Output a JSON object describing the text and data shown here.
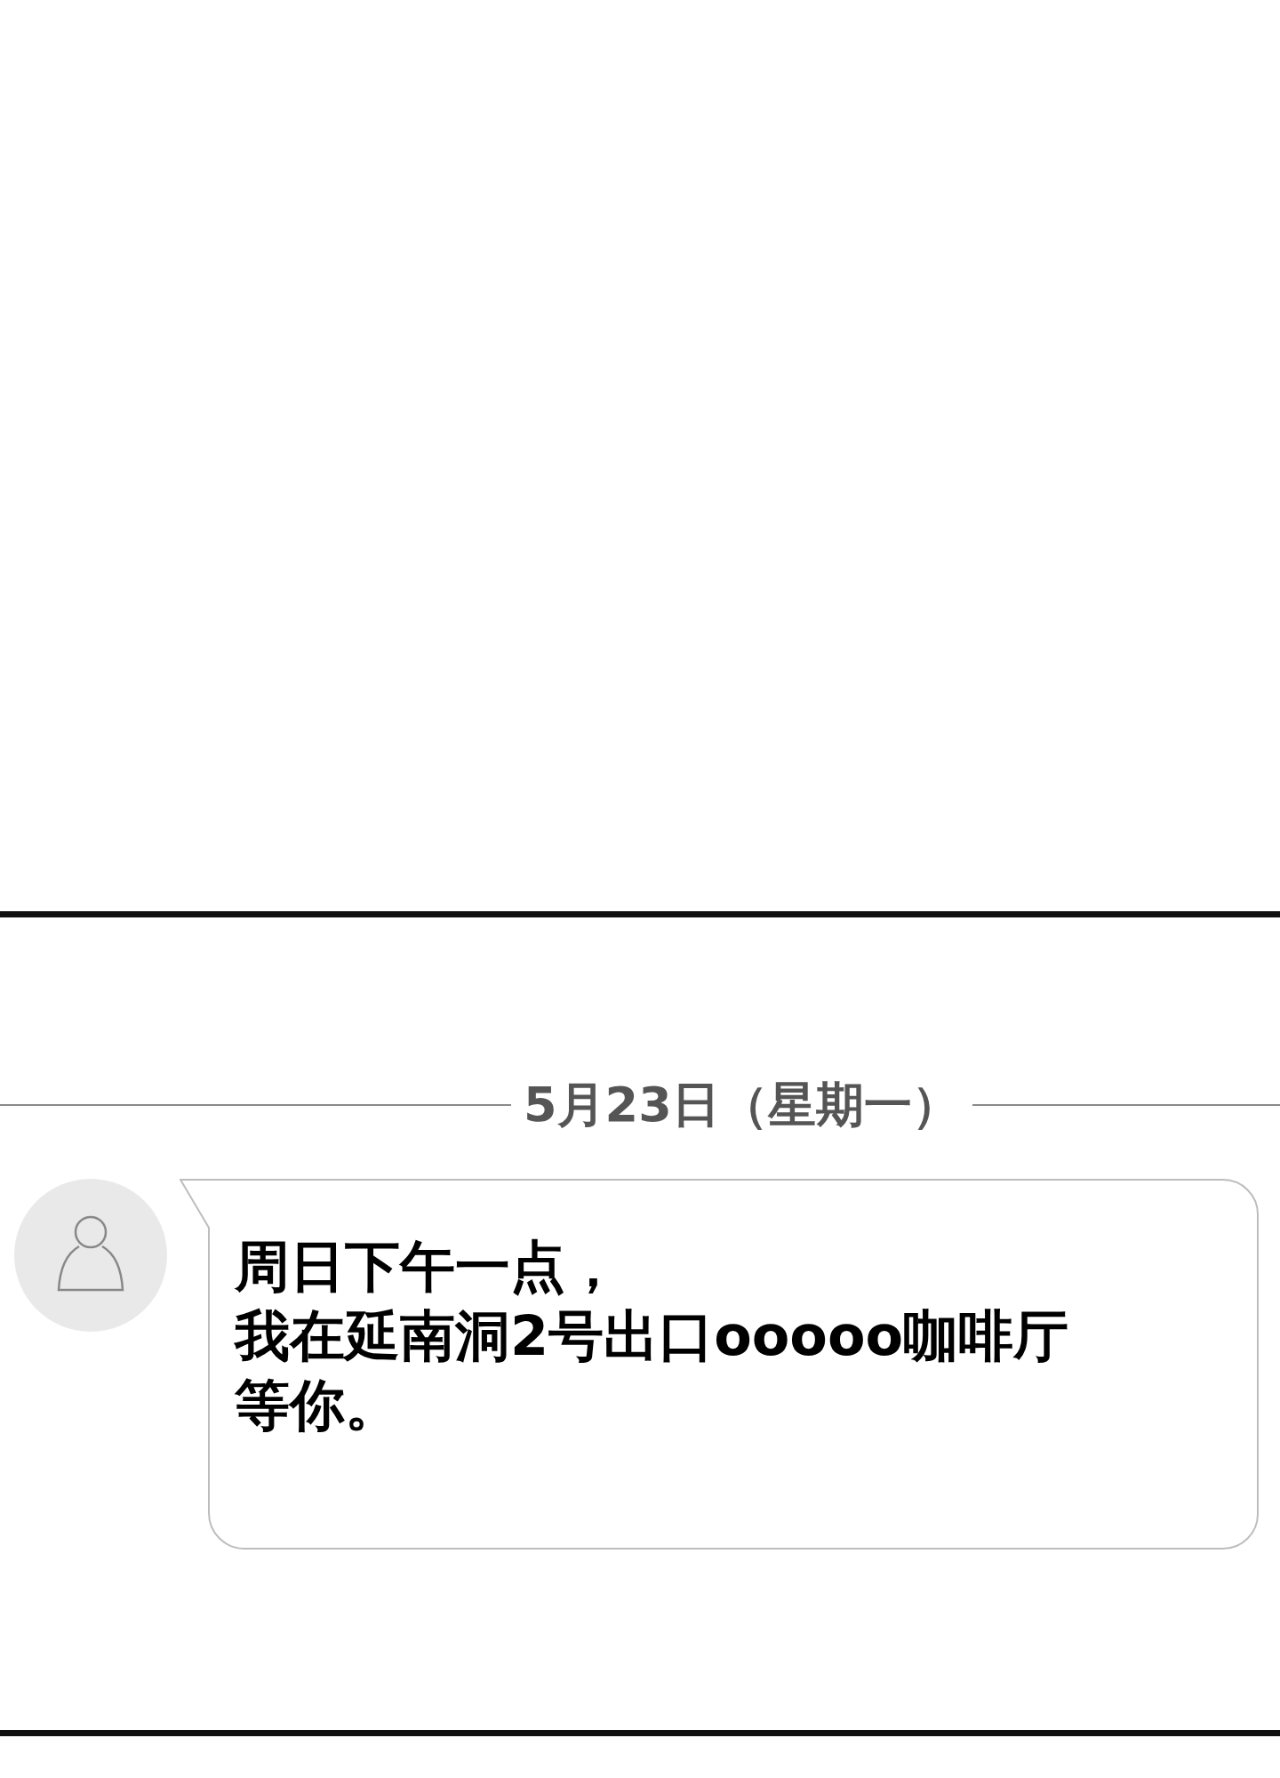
{
  "date_divider": "5月23日（星期一）",
  "message": {
    "lines": [
      "周日下午一点，",
      "我在延南洞2号出口ooooo咖啡厅",
      "等你。"
    ]
  }
}
